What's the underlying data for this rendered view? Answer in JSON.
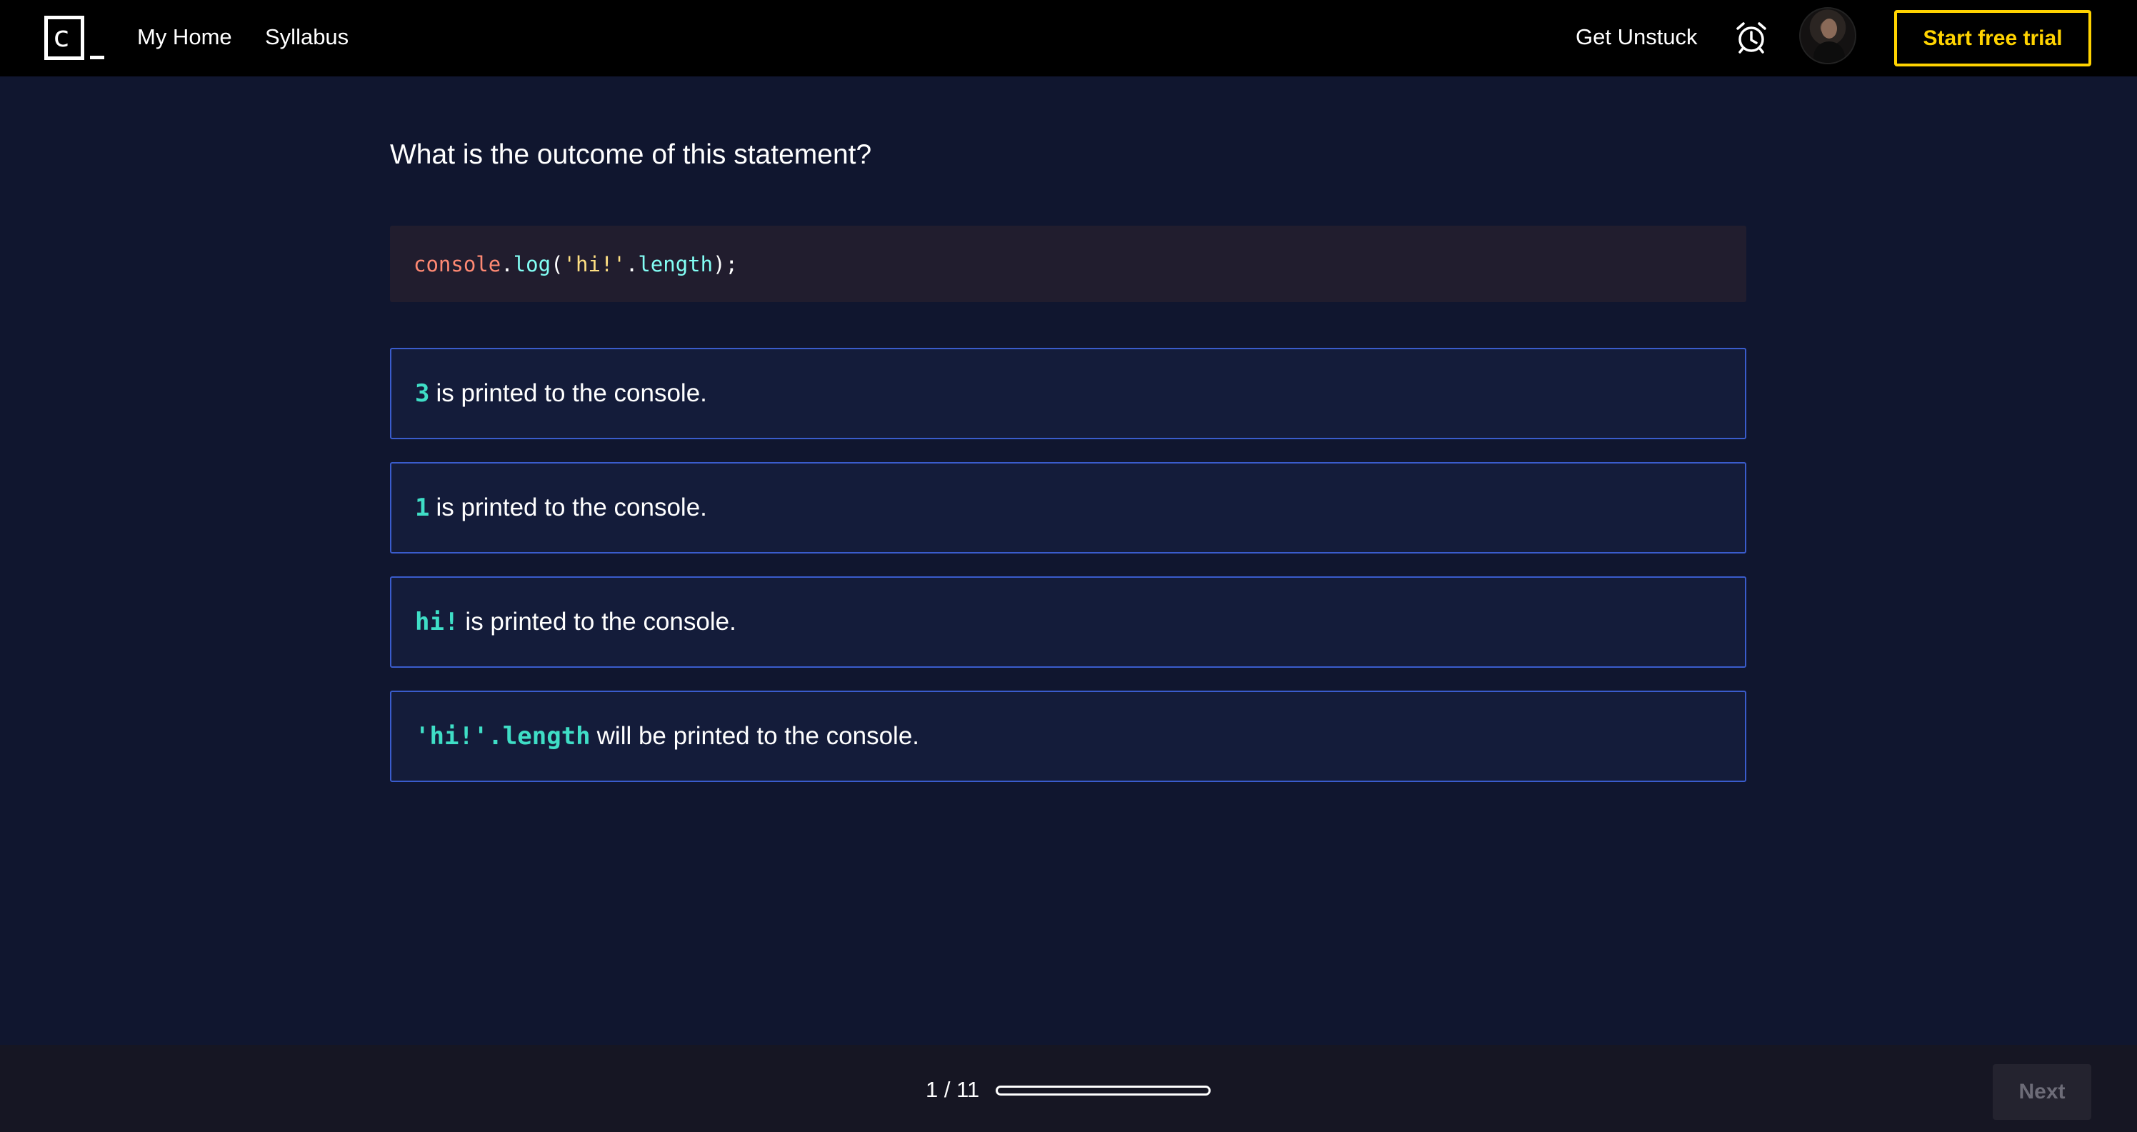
{
  "header": {
    "logo_letter": "c",
    "nav": {
      "home": "My Home",
      "syllabus": "Syllabus"
    },
    "get_unstuck": "Get Unstuck",
    "trial_button": "Start free trial",
    "icons": {
      "alarm": "alarm-clock-icon",
      "avatar": "user-avatar"
    },
    "accent_color": "#ffd300"
  },
  "quiz": {
    "question": "What is the outcome of this statement?",
    "code": {
      "object": "console",
      "dot1": ".",
      "method": "log",
      "open": "(",
      "string": "'hi!'",
      "dot2": ".",
      "property": "length",
      "close": ");"
    },
    "options": [
      {
        "code": "3",
        "text": "is printed to the console."
      },
      {
        "code": "1",
        "text": "is printed to the console."
      },
      {
        "code": "hi!",
        "text": "is printed to the console."
      },
      {
        "code": "'hi!'.length",
        "text": "will be printed to the console."
      }
    ]
  },
  "footer": {
    "progress_label": "1 / 11",
    "progress_fraction": 0.0,
    "next_button": "Next"
  }
}
